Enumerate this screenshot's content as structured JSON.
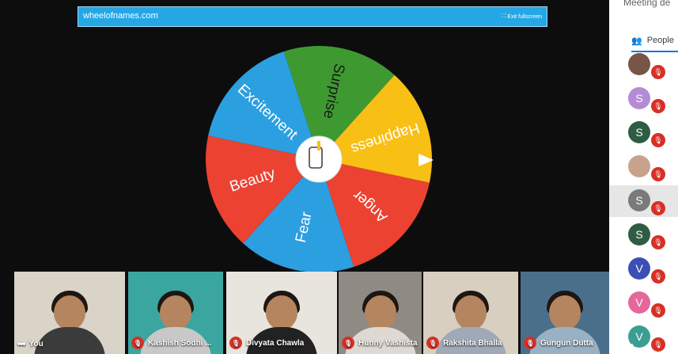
{
  "banner": {
    "url": "wheelofnames.com",
    "exit_label": "Exit fullscreen"
  },
  "wheel": {
    "segments": [
      {
        "label": "Surprise",
        "color": "#3e9a30"
      },
      {
        "label": "Happiness",
        "color": "#f8bf14"
      },
      {
        "label": "Anger",
        "color": "#eb4232"
      },
      {
        "label": "Fear",
        "color": "#2c9fe0"
      },
      {
        "label": "Beauty",
        "color": "#eb4232"
      },
      {
        "label": "Excitement",
        "color": "#2c9fe0"
      }
    ]
  },
  "panel": {
    "title": "Meeting de",
    "people_tab": "People",
    "participants": [
      {
        "initial": "",
        "color": "#795548"
      },
      {
        "initial": "S",
        "color": "#b58bd6"
      },
      {
        "initial": "S",
        "color": "#2e5d43"
      },
      {
        "initial": "",
        "color": "#c7a38c"
      },
      {
        "initial": "S",
        "color": "#7a7a7a"
      },
      {
        "initial": "S",
        "color": "#2e5d43"
      },
      {
        "initial": "V",
        "color": "#3c4fb3"
      },
      {
        "initial": "V",
        "color": "#e6689a"
      },
      {
        "initial": "V",
        "color": "#3b9e91"
      }
    ]
  },
  "tiles": [
    {
      "name": "You",
      "bg": "#d9d3c8",
      "shirt": "#3b3b3b"
    },
    {
      "name": "Kashish Sodhi ...",
      "bg": "#3ba6a0",
      "shirt": "#c8c8c8"
    },
    {
      "name": "Divyata Chawla",
      "bg": "#e8e5de",
      "shirt": "#222"
    },
    {
      "name": "Hunny Vashista",
      "bg": "#8f8a84",
      "shirt": "#ded9d2"
    },
    {
      "name": "Rakshita Bhalla",
      "bg": "#d8cfc1",
      "shirt": "#9fa9b7"
    },
    {
      "name": "Gungun Dutta",
      "bg": "#4a6f8b",
      "shirt": "#9ab1c4"
    }
  ]
}
